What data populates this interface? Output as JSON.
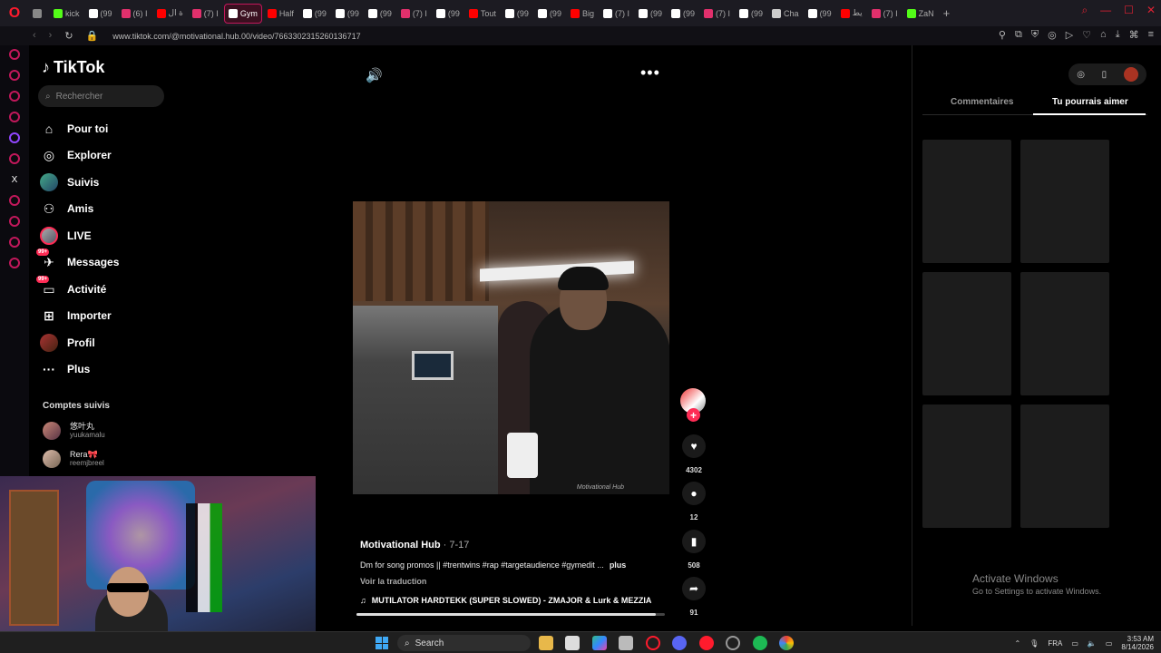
{
  "browser": {
    "url": "www.tiktok.com/@motivational.hub.00/video/7663302315260136717",
    "tabs": [
      {
        "label": "",
        "color": "#888888"
      },
      {
        "label": "kick",
        "color": "#53fc18"
      },
      {
        "label": "(99",
        "color": "#ffffff"
      },
      {
        "label": "(6) I",
        "color": "#e1306c"
      },
      {
        "label": "ة ال",
        "color": "#ff0000"
      },
      {
        "label": "(7) I",
        "color": "#e1306c"
      },
      {
        "label": "Gym",
        "color": "#ffffff",
        "active": true
      },
      {
        "label": "Half",
        "color": "#ff0000"
      },
      {
        "label": "(99",
        "color": "#ffffff"
      },
      {
        "label": "(99",
        "color": "#ffffff"
      },
      {
        "label": "(99",
        "color": "#ffffff"
      },
      {
        "label": "(7) I",
        "color": "#e1306c"
      },
      {
        "label": "(99",
        "color": "#ffffff"
      },
      {
        "label": "Tout",
        "color": "#ff0000"
      },
      {
        "label": "(99",
        "color": "#ffffff"
      },
      {
        "label": "(99",
        "color": "#ffffff"
      },
      {
        "label": "Big",
        "color": "#ff0000"
      },
      {
        "label": "(7) I",
        "color": "#ffffff"
      },
      {
        "label": "(99",
        "color": "#ffffff"
      },
      {
        "label": "(99",
        "color": "#ffffff"
      },
      {
        "label": "(7) I",
        "color": "#e1306c"
      },
      {
        "label": "(99",
        "color": "#ffffff"
      },
      {
        "label": "Cha",
        "color": "#cccccc"
      },
      {
        "label": "(99",
        "color": "#ffffff"
      },
      {
        "label": "يط",
        "color": "#ff0000"
      },
      {
        "label": "(7) I",
        "color": "#e1306c"
      },
      {
        "label": "ZaN",
        "color": "#53fc18"
      }
    ]
  },
  "tiktok": {
    "logo": "TikTok",
    "search_placeholder": "Rechercher",
    "nav": [
      {
        "label": "Pour toi",
        "icon": "home-icon"
      },
      {
        "label": "Explorer",
        "icon": "compass-icon"
      },
      {
        "label": "Suivis",
        "icon": "avatar"
      },
      {
        "label": "Amis",
        "icon": "friends-icon"
      },
      {
        "label": "LIVE",
        "icon": "avatar"
      },
      {
        "label": "Messages",
        "icon": "message-icon",
        "badge": "99+"
      },
      {
        "label": "Activité",
        "icon": "inbox-icon",
        "badge": "99+"
      },
      {
        "label": "Importer",
        "icon": "plus-square-icon"
      },
      {
        "label": "Profil",
        "icon": "avatar"
      },
      {
        "label": "Plus",
        "icon": "ellipsis-icon"
      }
    ],
    "followed_title": "Comptes suivis",
    "followed": [
      {
        "name": "悠叶丸",
        "handle": "yuukamalu"
      },
      {
        "name": "Rera🎀",
        "handle": "reemjbreel"
      }
    ]
  },
  "video": {
    "author": "Motivational Hub",
    "date": " · 7-17",
    "description": "Dm for song promos || #trentwins #rap #targetaudience #gymedit ...",
    "more_label": "plus",
    "translate_label": "Voir la traduction",
    "music": "MUTILATOR HARDTEKK (SUPER SLOWED) - ZMAJOR & Lurk & MEZZIA",
    "progress": 0.97,
    "watermark": "Motivational Hub",
    "likes": "4302",
    "comments": "12",
    "saves": "508",
    "shares": "91"
  },
  "right_panel": {
    "tabs": [
      "Commentaires",
      "Tu pourrais aimer"
    ],
    "active_tab": 1
  },
  "windows": {
    "activate_title": "Activate Windows",
    "activate_sub": "Go to Settings to activate Windows.",
    "search": "Search",
    "lang": "FRA",
    "time": "3:53 AM",
    "date": "8/14/2026"
  }
}
